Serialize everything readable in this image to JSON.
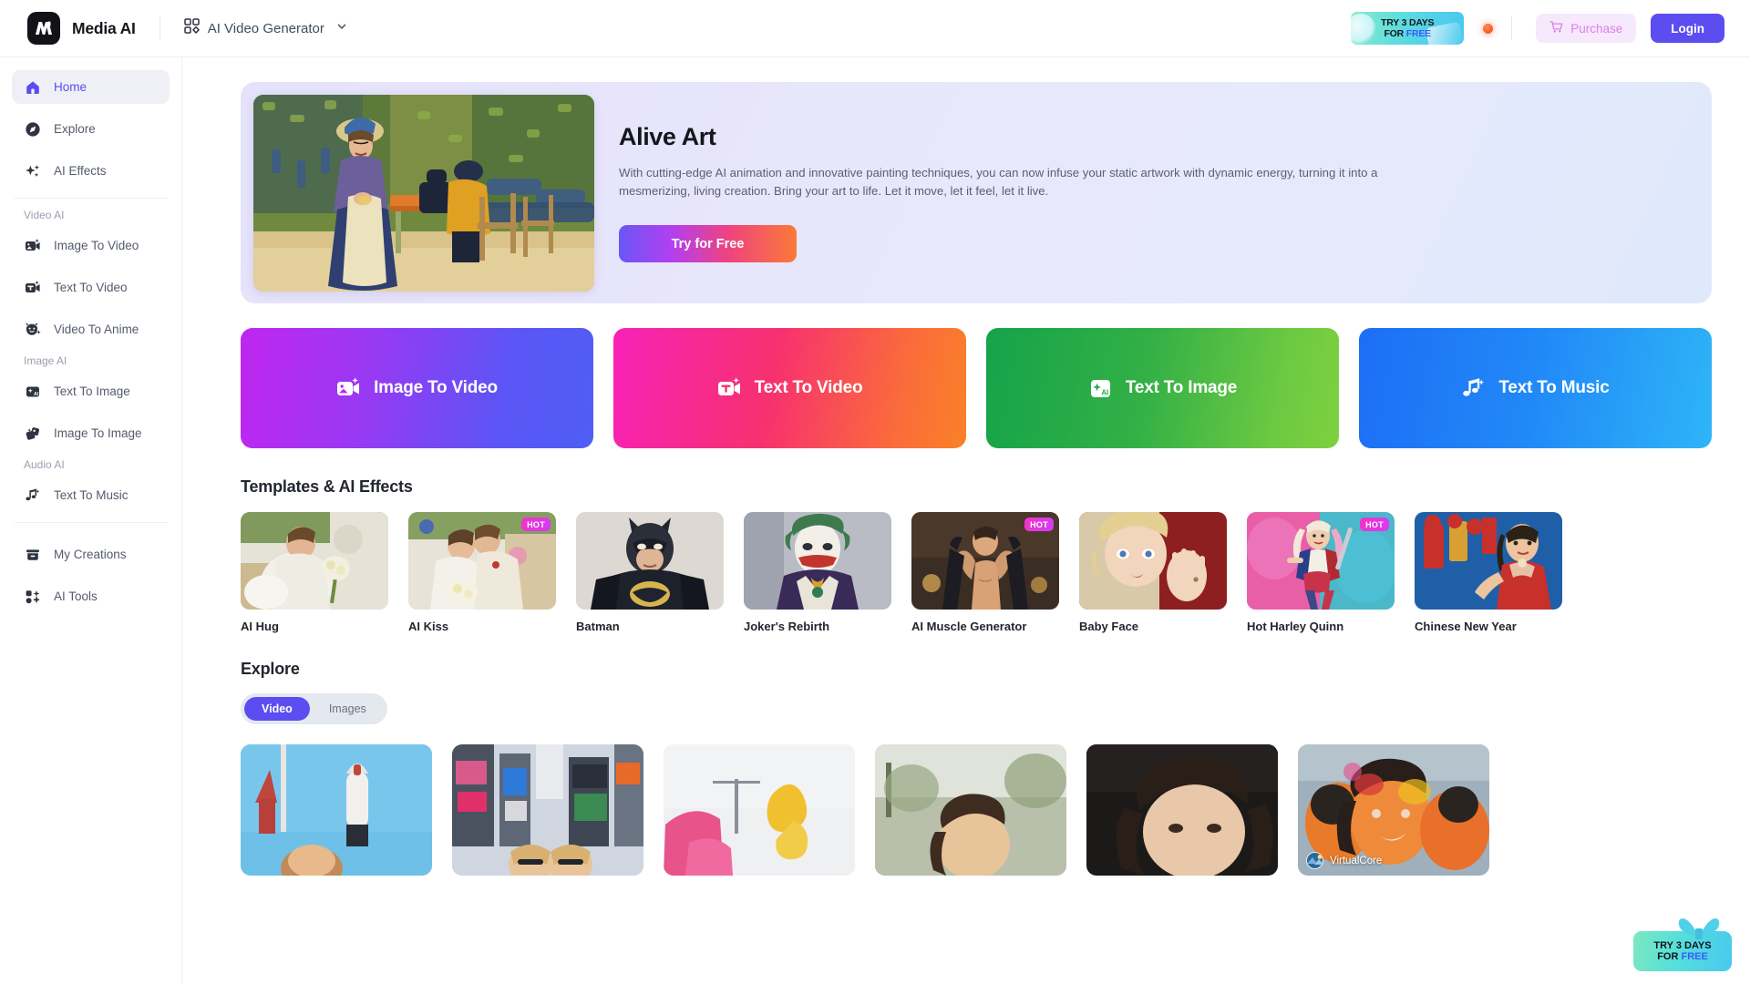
{
  "header": {
    "brand_name": "Media AI",
    "logo_icon": "media-ai-logo",
    "model_selector": {
      "icon": "grid-apps-icon",
      "label": "AI Video Generator",
      "chevron": "chevron-down-icon"
    },
    "promo_banner": {
      "line1": "TRY 3 DAYS",
      "line2_prefix": "FOR ",
      "line2_accent": "FREE"
    },
    "notification_icon": "notification-dot-icon",
    "purchase_button": {
      "icon": "cart-icon",
      "label": "Purchase"
    },
    "login_button": {
      "label": "Login"
    }
  },
  "sidebar": {
    "top_items": [
      {
        "label": "Home",
        "icon": "home-icon",
        "active": true
      },
      {
        "label": "Explore",
        "icon": "compass-icon",
        "active": false
      },
      {
        "label": "AI Effects",
        "icon": "sparkles-icon",
        "active": false
      }
    ],
    "groups": [
      {
        "title": "Video AI",
        "items": [
          {
            "label": "Image To Video",
            "icon": "image-video-icon"
          },
          {
            "label": "Text To Video",
            "icon": "text-video-icon"
          },
          {
            "label": "Video To Anime",
            "icon": "anime-face-icon"
          }
        ]
      },
      {
        "title": "Image AI",
        "items": [
          {
            "label": "Text To Image",
            "icon": "text-image-icon"
          },
          {
            "label": "Image To Image",
            "icon": "image-image-icon"
          }
        ]
      },
      {
        "title": "Audio AI",
        "items": [
          {
            "label": "Text To Music",
            "icon": "music-note-icon"
          }
        ]
      }
    ],
    "bottom_items": [
      {
        "label": "My Creations",
        "icon": "archive-box-icon"
      },
      {
        "label": "AI Tools",
        "icon": "tools-grid-icon"
      }
    ]
  },
  "hero": {
    "title": "Alive Art",
    "description": "With cutting-edge AI animation and innovative painting techniques, you can now infuse your static artwork with dynamic energy, turning it into a mesmerizing, living creation. Bring your art to life. Let it move, let it feel, let it live.",
    "cta_label": "Try for Free",
    "artwork_name": "post-impressionist-garden-cafe-painting"
  },
  "action_cards": [
    {
      "label": "Image To Video",
      "icon": "image-video-icon",
      "color_from": "#c026f0",
      "color_to": "#4f5ef5"
    },
    {
      "label": "Text To Video",
      "icon": "text-video-icon",
      "color_from": "#f721b8",
      "color_to": "#f98128"
    },
    {
      "label": "Text To Image",
      "icon": "text-image-icon",
      "color_from": "#15a34a",
      "color_to": "#7ed13f"
    },
    {
      "label": "Text To Music",
      "icon": "music-note-icon",
      "color_from": "#1d6ef5",
      "color_to": "#2eb5f7"
    }
  ],
  "templates_section": {
    "title": "Templates & AI Effects",
    "hot_badge_label": "HOT",
    "items": [
      {
        "label": "AI Hug",
        "hot": false,
        "thumb": "wedding-hug-photo"
      },
      {
        "label": "AI Kiss",
        "hot": true,
        "thumb": "wedding-kiss-photo"
      },
      {
        "label": "Batman",
        "hot": false,
        "thumb": "batman-costume-photo"
      },
      {
        "label": "Joker's Rebirth",
        "hot": false,
        "thumb": "joker-makeup-photo"
      },
      {
        "label": "AI Muscle Generator",
        "hot": true,
        "thumb": "muscular-man-photo"
      },
      {
        "label": "Baby Face",
        "hot": false,
        "thumb": "baby-face-photo"
      },
      {
        "label": "Hot Harley Quinn",
        "hot": true,
        "thumb": "harley-quinn-photo"
      },
      {
        "label": "Chinese New Year",
        "hot": false,
        "thumb": "chinese-new-year-photo"
      }
    ]
  },
  "explore_section": {
    "title": "Explore",
    "tabs": [
      {
        "label": "Video",
        "active": true
      },
      {
        "label": "Images",
        "active": false
      }
    ],
    "items": [
      {
        "thumb": "rocket-launch-video",
        "author": ""
      },
      {
        "thumb": "times-square-friends-video",
        "author": ""
      },
      {
        "thumb": "pink-yellow-smoke-video",
        "author": ""
      },
      {
        "thumb": "outdoor-portrait-video",
        "author": ""
      },
      {
        "thumb": "dark-hair-portrait-video",
        "author": ""
      },
      {
        "thumb": "holi-festival-video",
        "author": "VirtualCore"
      }
    ]
  },
  "floating_promo": {
    "line1": "TRY 3 DAYS",
    "line2_prefix": "FOR ",
    "line2_accent": "FREE",
    "icon": "gift-bow-icon"
  },
  "colors": {
    "accent_purple": "#5b4df0",
    "hot_badge": "#f033c9",
    "purchase_pink": "#e07cf0",
    "notification_orange": "#f4441d"
  }
}
